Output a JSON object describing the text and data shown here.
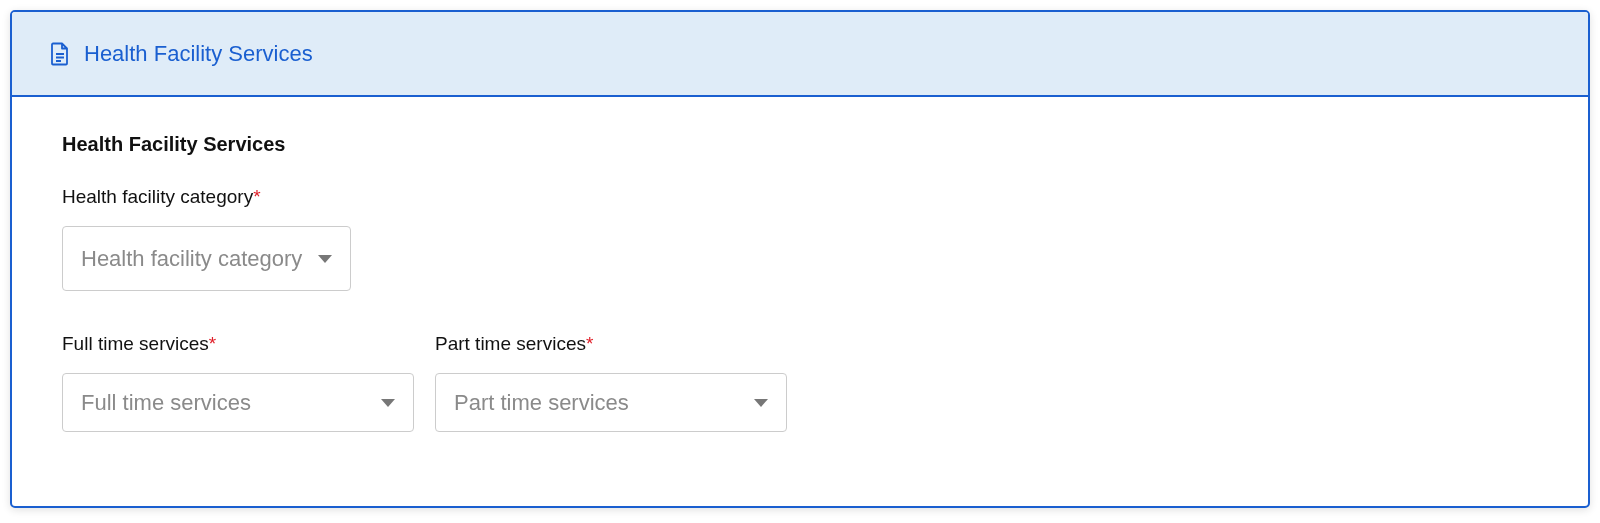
{
  "panel": {
    "title": "Health Facility Services"
  },
  "section": {
    "heading": "Health Facility Services",
    "rows": [
      [
        {
          "label": "Health facility category",
          "required_mark": "*",
          "placeholder": "Health facility category"
        }
      ],
      [
        {
          "label": "Full time services",
          "required_mark": "*",
          "placeholder": "Full time services"
        },
        {
          "label": "Part time services",
          "required_mark": "*",
          "placeholder": "Part time services"
        }
      ]
    ]
  }
}
